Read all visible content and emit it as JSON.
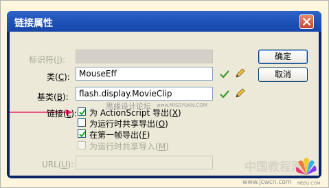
{
  "window": {
    "title": "链接属性"
  },
  "form": {
    "identifier": {
      "label": "标识符(",
      "key": "I",
      "suffix": "):",
      "value": ""
    },
    "class": {
      "label": "类(",
      "key": "C",
      "suffix": "):",
      "value": "MouseEff"
    },
    "base_class": {
      "label": "基类(",
      "key": "B",
      "suffix": "):",
      "value": "flash.display.MovieClip"
    },
    "linkage": {
      "label": "链接(",
      "key": "L",
      "suffix": "):"
    },
    "url": {
      "label": "URL(",
      "key": "U",
      "suffix": "):",
      "value": ""
    }
  },
  "checkboxes": [
    {
      "label": "为 ActionScript 导出(",
      "key": "X",
      "suffix": ")",
      "checked": true,
      "enabled": true
    },
    {
      "label": "为运行时共享导出(",
      "key": "O",
      "suffix": ")",
      "checked": false,
      "enabled": true
    },
    {
      "label": "在第一帧导出(",
      "key": "F",
      "suffix": ")",
      "checked": true,
      "enabled": true
    },
    {
      "label": "为运行时共享导入(",
      "key": "M",
      "suffix": ")",
      "checked": false,
      "enabled": false
    }
  ],
  "buttons": {
    "ok": "确定",
    "cancel": "取消"
  },
  "watermarks": {
    "forum": "思缘设计论坛",
    "forum_url": "www.MISSYUAN.COM",
    "site_cn": "中国教程网",
    "site_url": "www.jcwcn.com",
    "site_small": "MBSU.COM"
  },
  "colors": {
    "title_bar": "#1d4fb5",
    "dialog_bg": "#ece9d8",
    "arrow": "#e8236a",
    "check": "#3a9a2a"
  },
  "icons": [
    "close-icon",
    "checkmark-icon",
    "pencil-icon",
    "arrow-icon",
    "logo-flower-icon"
  ]
}
